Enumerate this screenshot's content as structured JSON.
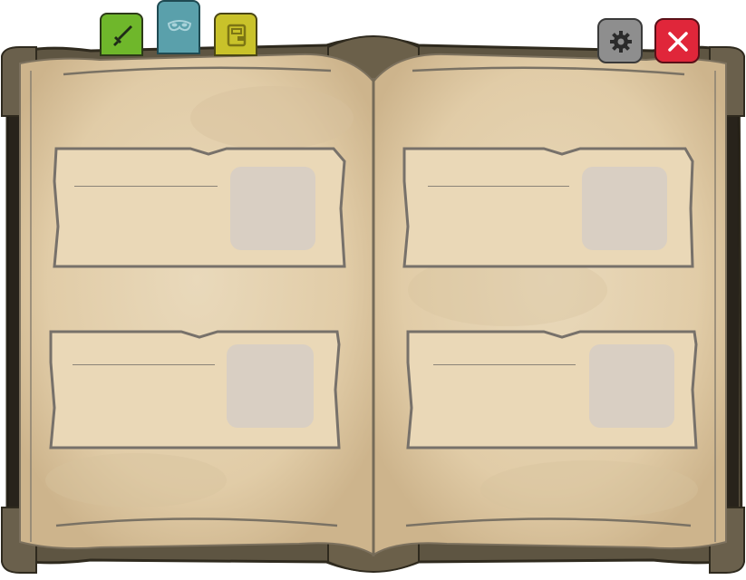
{
  "tabs": [
    {
      "id": "weapons",
      "icon": "sword-icon",
      "color": "#6fb72b"
    },
    {
      "id": "masks",
      "icon": "mask-icon",
      "color": "#5aa0ab"
    },
    {
      "id": "journal",
      "icon": "journal-icon",
      "color": "#c9c22a"
    }
  ],
  "controls": {
    "settings": {
      "icon": "gear-icon",
      "color": "#8e8e8e"
    },
    "close": {
      "icon": "close-icon",
      "color": "#e0263a"
    }
  },
  "book": {
    "cover_color": "#5e5542",
    "page_color": "#e6d4b4",
    "left_page": {
      "cards": [
        {
          "title": ""
        },
        {
          "title": ""
        }
      ]
    },
    "right_page": {
      "cards": [
        {
          "title": ""
        },
        {
          "title": ""
        }
      ]
    }
  }
}
